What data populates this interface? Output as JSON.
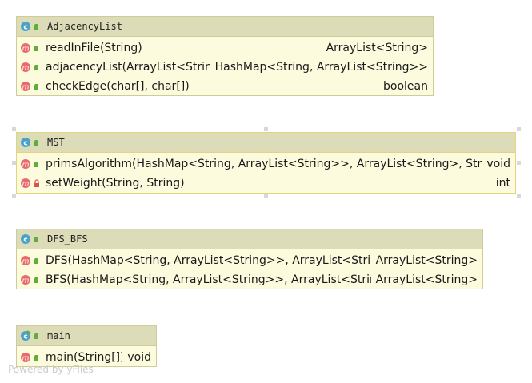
{
  "colors": {
    "class_background": "#fdfbde",
    "header_background": "#dddcb9",
    "border": "#cfcc99",
    "class_icon": "#4aa2c8",
    "method_icon": "#e86a6a",
    "public_access": "#5fae3a",
    "private_access": "#d9534f"
  },
  "classes": {
    "adjacency_list": {
      "name": "AdjacencyList",
      "icon": "class-icon",
      "members": [
        {
          "signature": "readInFile(String)",
          "type": "ArrayList<String>",
          "icon": "method-icon",
          "access": "public"
        },
        {
          "signature": "adjacencyList(ArrayList<String>)",
          "type": "HashMap<String, ArrayList<String>>",
          "icon": "method-icon",
          "access": "public"
        },
        {
          "signature": "checkEdge(char[], char[])",
          "type": "boolean",
          "icon": "method-icon",
          "access": "public"
        }
      ]
    },
    "mst": {
      "name": "MST",
      "icon": "class-icon",
      "members": [
        {
          "signature": "primsAlgorithm(HashMap<String, ArrayList<String>>, ArrayList<String>, String)",
          "type": "void",
          "icon": "method-icon",
          "access": "public"
        },
        {
          "signature": "setWeight(String, String)",
          "type": "int",
          "icon": "method-icon",
          "access": "private"
        }
      ]
    },
    "dfs_bfs": {
      "name": "DFS_BFS",
      "icon": "class-icon",
      "members": [
        {
          "signature": "DFS(HashMap<String, ArrayList<String>>, ArrayList<String>)",
          "type": "ArrayList<String>",
          "icon": "method-icon",
          "access": "public"
        },
        {
          "signature": "BFS(HashMap<String, ArrayList<String>>, ArrayList<String>)",
          "type": "ArrayList<String>",
          "icon": "method-icon",
          "access": "public"
        }
      ]
    },
    "main": {
      "name": "main",
      "icon": "runnable-class-icon",
      "members": [
        {
          "signature": "main(String[])",
          "type": "void",
          "icon": "method-icon",
          "access": "public"
        }
      ]
    }
  },
  "watermark": "Powered by yFiles"
}
